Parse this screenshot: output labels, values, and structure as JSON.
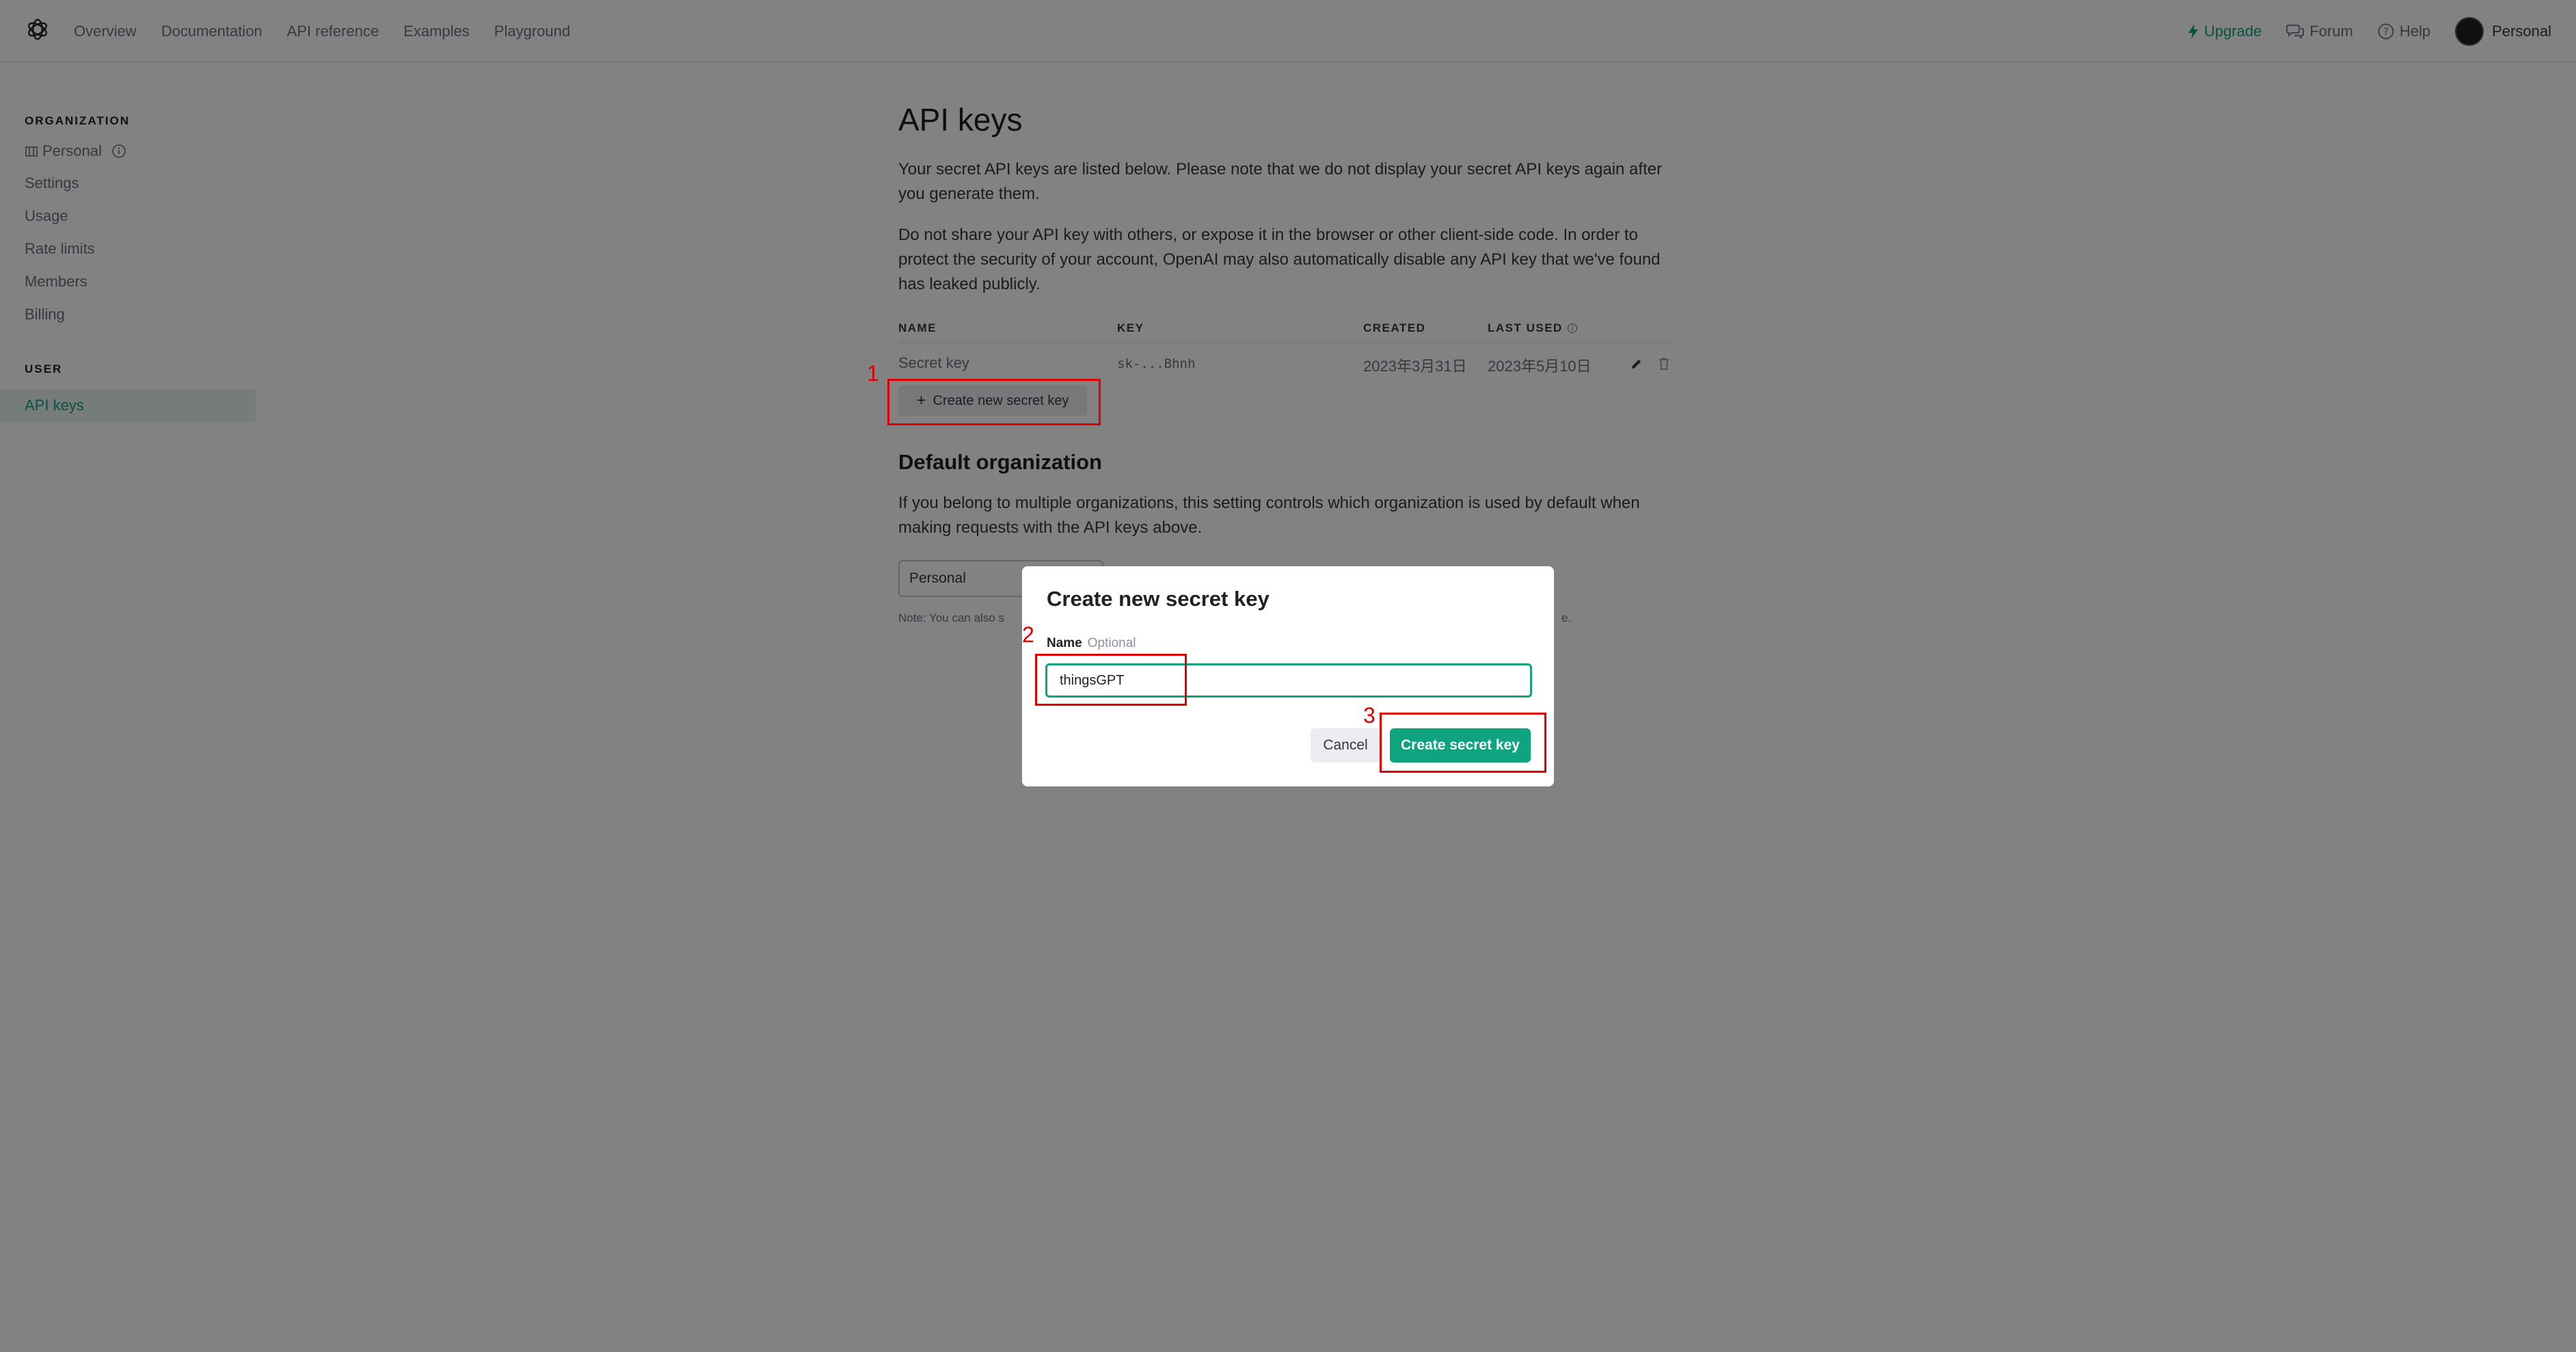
{
  "nav": {
    "links": [
      "Overview",
      "Documentation",
      "API reference",
      "Examples",
      "Playground"
    ],
    "upgrade": "Upgrade",
    "forum": "Forum",
    "help": "Help",
    "account": "Personal"
  },
  "sidebar": {
    "org_heading": "ORGANIZATION",
    "org_name": "Personal",
    "items": [
      "Settings",
      "Usage",
      "Rate limits",
      "Members",
      "Billing"
    ],
    "user_heading": "USER",
    "active_item": "API keys"
  },
  "main": {
    "title": "API keys",
    "para1": "Your secret API keys are listed below. Please note that we do not display your secret API keys again after you generate them.",
    "para2": "Do not share your API key with others, or expose it in the browser or other client-side code. In order to protect the security of your account, OpenAI may also automatically disable any API key that we've found has leaked publicly.",
    "table": {
      "headers": [
        "NAME",
        "KEY",
        "CREATED",
        "LAST USED"
      ],
      "row": {
        "name": "Secret key",
        "key": "sk-...Bhnh",
        "created": "2023年3月31日",
        "last_used": "2023年5月10日"
      }
    },
    "create_button": "Create new secret key",
    "default_org_title": "Default organization",
    "default_org_desc": "If you belong to multiple organizations, this setting controls which organization is used by default when making requests with the API keys above.",
    "org_select_value": "Personal",
    "note_prefix": "Note: You can also s",
    "note_suffix": "e."
  },
  "modal": {
    "title": "Create new secret key",
    "label": "Name",
    "optional": "Optional",
    "input_value": "thingsGPT",
    "cancel": "Cancel",
    "submit": "Create secret key"
  },
  "annotations": [
    "1",
    "2",
    "3"
  ],
  "colors": {
    "accent": "#10a37f",
    "annotation": "#e00000",
    "overlay": "rgba(0,0,0,0.49)"
  }
}
